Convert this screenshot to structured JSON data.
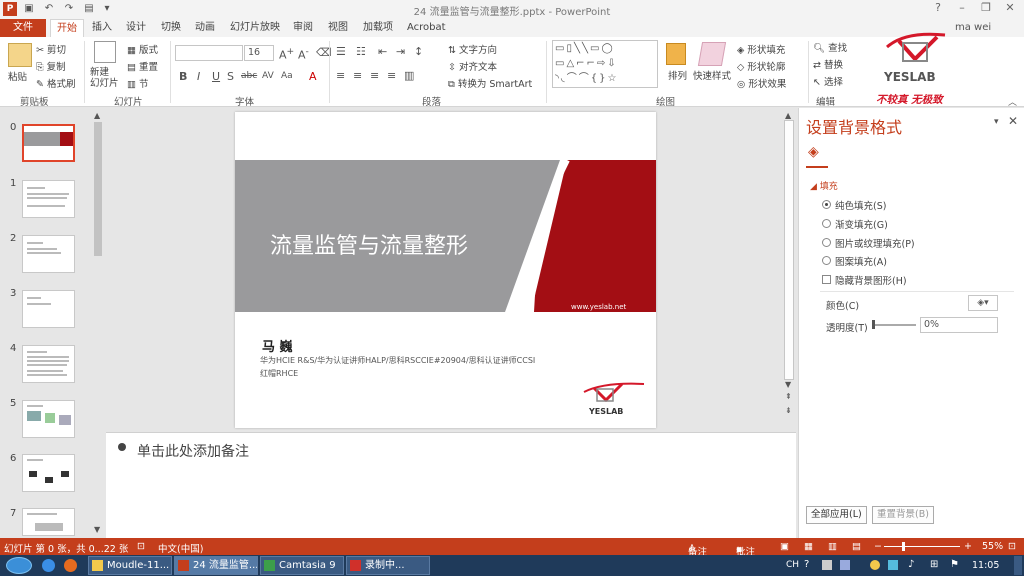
{
  "window": {
    "title": "24 流量监管与流量整形.pptx - PowerPoint",
    "user": "ma wei",
    "controls": [
      "?",
      "–",
      "❐",
      "✕"
    ],
    "qat_icons": [
      "save-icon",
      "undo-icon",
      "redo-icon",
      "slideshow-icon"
    ]
  },
  "tabs": [
    {
      "label": "文件"
    },
    {
      "label": "开始"
    },
    {
      "label": "插入"
    },
    {
      "label": "设计"
    },
    {
      "label": "切换"
    },
    {
      "label": "动画"
    },
    {
      "label": "幻灯片放映"
    },
    {
      "label": "审阅"
    },
    {
      "label": "视图"
    },
    {
      "label": "加载项"
    },
    {
      "label": "Acrobat"
    }
  ],
  "ribbon": {
    "clipboard": {
      "paste": "粘贴",
      "cut": "剪切",
      "copy": "复制",
      "format_painter": "格式刷",
      "group": "剪贴板"
    },
    "slides": {
      "new_slide": "新建\n幻灯片",
      "layout": "版式",
      "reset": "重置",
      "section": "节",
      "group": "幻灯片"
    },
    "font": {
      "font_name": "",
      "font_size": "16",
      "group": "字体",
      "buttons": [
        "B",
        "I",
        "U",
        "S",
        "abc",
        "AV",
        "Aa",
        "A"
      ]
    },
    "paragraph": {
      "text_direction": "文字方向",
      "align_text": "对齐文本",
      "smartart": "转换为 SmartArt",
      "group": "段落"
    },
    "drawing": {
      "arrange": "排列",
      "quick_styles": "快速样式",
      "shape_fill": "形状填充",
      "shape_outline": "形状轮廓",
      "shape_effects": "形状效果",
      "group": "绘图"
    },
    "editing": {
      "find": "查找",
      "replace": "替换",
      "select": "选择",
      "group": "编辑"
    },
    "logo": {
      "brand": "YESLAB",
      "slogan": "不较真 无极致"
    }
  },
  "thumbnails": [
    {
      "num": "0",
      "selected": true
    },
    {
      "num": "1"
    },
    {
      "num": "2"
    },
    {
      "num": "3"
    },
    {
      "num": "4"
    },
    {
      "num": "5"
    },
    {
      "num": "6"
    },
    {
      "num": "7"
    }
  ],
  "slide": {
    "title": "流量监管与流量整形",
    "url": "www.yeslab.net",
    "author": "马 巍",
    "info_line1": "华为HCIE R&S/华为认证讲师HALP/思科RSCCIE#20904/思科认证讲师CCSI",
    "info_line2": "红帽RHCE",
    "logo": "YESLAB",
    "colors": {
      "gray": "#9a9a9c",
      "red": "#a30e14"
    }
  },
  "notes": {
    "placeholder": "单击此处添加备注"
  },
  "format_pane": {
    "title": "设置背景格式",
    "section": "填充",
    "options": [
      {
        "label": "纯色填充(S)",
        "checked": true
      },
      {
        "label": "渐变填充(G)",
        "checked": false
      },
      {
        "label": "图片或纹理填充(P)",
        "checked": false
      },
      {
        "label": "图案填充(A)",
        "checked": false
      }
    ],
    "hide_graphics": "隐藏背景图形(H)",
    "color_label": "颜色(C)",
    "transparency_label": "透明度(T)",
    "transparency_value": "0%",
    "apply_all": "全部应用(L)",
    "reset": "重置背景(B)"
  },
  "status": {
    "slide_info": "幻灯片 第 0 张，共 0...22 张",
    "language": "中文(中国)",
    "notes": "备注",
    "comments": "批注",
    "zoom": "55%"
  },
  "taskbar": {
    "items": [
      {
        "label": "Moudle-11..."
      },
      {
        "label": "24 流量监管..."
      },
      {
        "label": "Camtasia 9"
      },
      {
        "label": "录制中..."
      }
    ],
    "tray": "CH",
    "time": "11:05"
  }
}
